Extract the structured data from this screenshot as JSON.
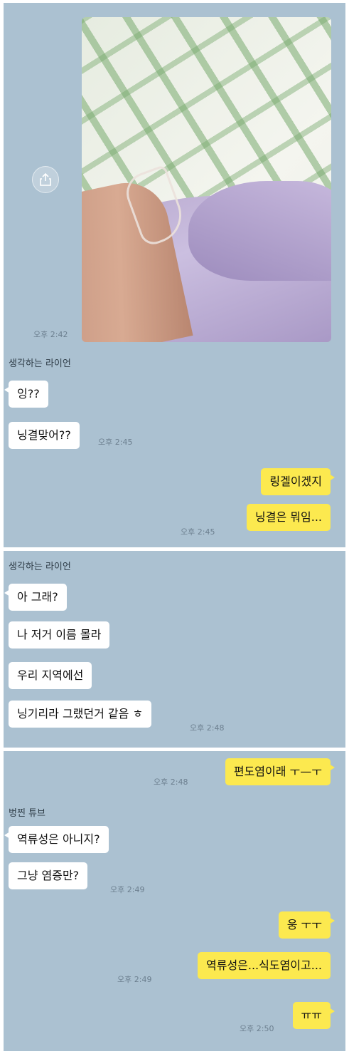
{
  "colors": {
    "chat_background": "#abc1d1",
    "incoming_bubble": "#ffffff",
    "outgoing_bubble": "#fce94f"
  },
  "panel1": {
    "photo_time": "오후 2:42",
    "sender": "생각하는 라이언",
    "messages_in": [
      "잉??",
      "닝결맞어??"
    ],
    "time_in": "오후 2:45",
    "messages_out": [
      "링겔이겠지",
      "닝결은 뭐임..."
    ],
    "time_out": "오후 2:45"
  },
  "panel2": {
    "sender": "생각하는 라이언",
    "messages_in": [
      "아 그래?",
      "나 저거 이름 몰라",
      "우리 지역에선",
      "닝기리라 그랬던거 같음 ㅎ"
    ],
    "time_in": "오후 2:48"
  },
  "panel3": {
    "out_first": "편도염이래 ㅜ—ㅜ",
    "time_out_first": "오후 2:48",
    "sender": "벙찐 튜브",
    "messages_in": [
      "역류성은 아니지?",
      "그냥 염증만?"
    ],
    "time_in": "오후 2:49",
    "messages_out": [
      "웅 ㅜㅜ",
      "역류성은...식도염이고...",
      "ㅠㅠ"
    ],
    "time_out_mid": "오후 2:49",
    "time_out_last": "오후 2:50"
  },
  "icons": {
    "share": "share-icon"
  }
}
